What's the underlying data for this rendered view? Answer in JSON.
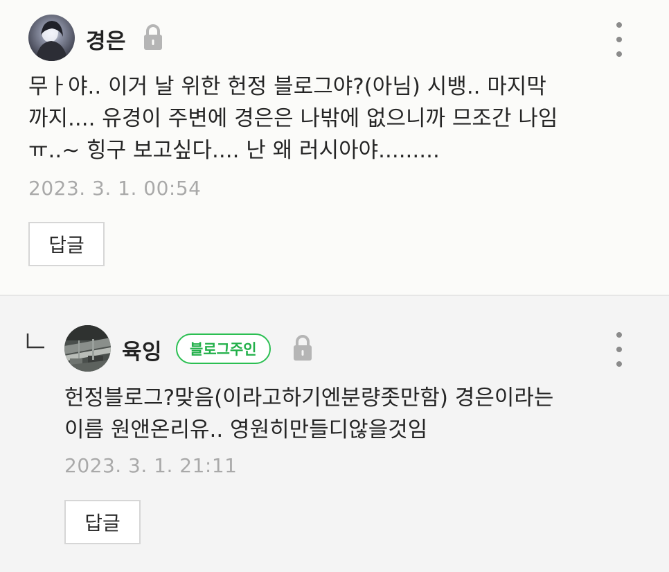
{
  "comments": [
    {
      "author": "경은",
      "text": "무ㅏ야.. 이거 날 위한 헌정 블로그야?(아님) 시뱅.. 마지막\n까지.... 유경이 주변에 경은은 나밖에 없으니까 므조간 나임\nㅠ..~ 힝구 보고싶다.... 난 왜 러시아야.........",
      "date": "2023. 3. 1. 00:54",
      "reply_label": "답글"
    },
    {
      "author": "육잉",
      "badge": "블로그주인",
      "text": "헌정블로그?맞음(이라고하기엔분량좃만함) 경은이라는\n이름 원앤온리유.. 영원히만들디않을것임",
      "date": "2023. 3. 1. 21:11",
      "reply_label": "답글"
    }
  ],
  "colors": {
    "badge_green": "#2bbf52",
    "date_gray": "#a9a9a9",
    "lock_gray": "#b5b5b5"
  },
  "icons": [
    "avatar",
    "lock-icon",
    "more-options-icon",
    "reply-arrow-icon"
  ]
}
